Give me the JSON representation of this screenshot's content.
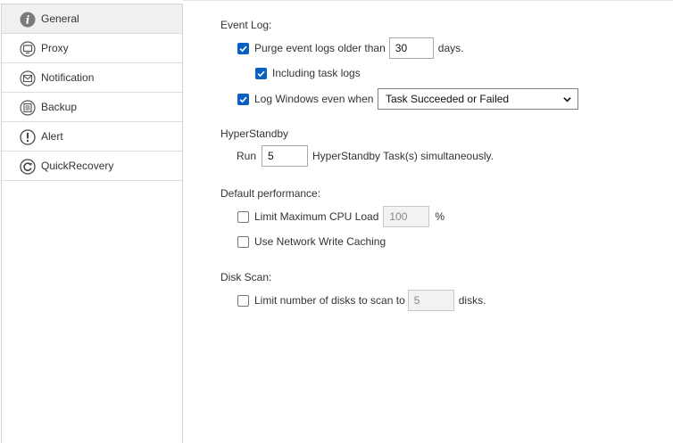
{
  "sidebar": {
    "items": [
      {
        "label": "General",
        "icon": "info-icon",
        "active": true
      },
      {
        "label": "Proxy",
        "icon": "monitor-icon",
        "active": false
      },
      {
        "label": "Notification",
        "icon": "envelope-icon",
        "active": false
      },
      {
        "label": "Backup",
        "icon": "document-list-icon",
        "active": false
      },
      {
        "label": "Alert",
        "icon": "exclamation-icon",
        "active": false
      },
      {
        "label": "QuickRecovery",
        "icon": "refresh-icon",
        "active": false
      }
    ]
  },
  "event_log": {
    "title": "Event Log:",
    "purge_label": "Purge event logs older than",
    "purge_checked": true,
    "purge_days": "30",
    "days_suffix": "days.",
    "include_task_label": "Including task logs",
    "include_task_checked": true,
    "log_windows_label": "Log Windows even when",
    "log_windows_checked": true,
    "log_windows_selected": "Task Succeeded or Failed"
  },
  "hyperstandby": {
    "title": "HyperStandby",
    "run_label": "Run",
    "run_value": "5",
    "run_suffix": "HyperStandby Task(s) simultaneously."
  },
  "performance": {
    "title": "Default performance:",
    "cpu_label": "Limit Maximum CPU Load",
    "cpu_checked": false,
    "cpu_value": "100",
    "cpu_suffix": "%",
    "network_label": "Use Network Write Caching",
    "network_checked": false
  },
  "disk_scan": {
    "title": "Disk Scan:",
    "limit_label": "Limit number of disks to scan to",
    "limit_checked": false,
    "limit_value": "5",
    "limit_suffix": "disks."
  },
  "colors": {
    "accent": "#0a5fc2",
    "active_bg": "#f0f0f0",
    "border": "#d4d4d4"
  }
}
